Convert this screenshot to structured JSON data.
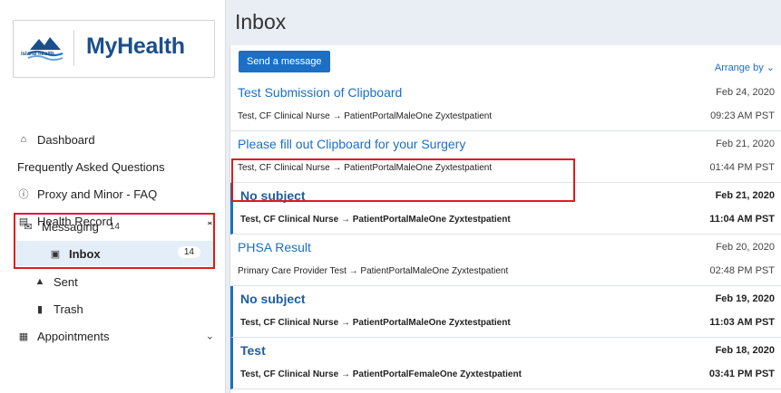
{
  "brand": {
    "title": "MyHealth",
    "mark_text": "island health"
  },
  "sidebar": {
    "items": [
      {
        "label": "Dashboard",
        "icon": "home-icon"
      },
      {
        "label": "Frequently Asked Questions"
      },
      {
        "label": "Proxy and Minor - FAQ",
        "icon": "help-circle-icon"
      },
      {
        "label": "Health Record",
        "icon": "clipboard-icon"
      },
      {
        "label": "Messaging",
        "icon": "envelope-icon",
        "badge": "14"
      },
      {
        "label": "Inbox",
        "icon": "inbox-icon",
        "badge": "14"
      },
      {
        "label": "Sent",
        "icon": "sent-icon"
      },
      {
        "label": "Trash",
        "icon": "trash-icon"
      },
      {
        "label": "Appointments",
        "icon": "calendar-icon"
      }
    ]
  },
  "main": {
    "title": "Inbox",
    "send_label": "Send a message",
    "arrange_label": "Arrange by",
    "messages": [
      {
        "subject": "Test Submission of Clipboard",
        "route": "Test, CF Clinical Nurse → PatientPortalMaleOne Zyxtestpatient",
        "date": "Feb 24, 2020",
        "time": "09:23 AM PST",
        "unread": false
      },
      {
        "subject": "Please fill out Clipboard for your Surgery",
        "route": "Test, CF Clinical Nurse → PatientPortalMaleOne Zyxtestpatient",
        "date": "Feb 21, 2020",
        "time": "01:44 PM PST",
        "unread": false
      },
      {
        "subject": "No subject",
        "route": "Test, CF Clinical Nurse → PatientPortalMaleOne Zyxtestpatient",
        "date": "Feb 21, 2020",
        "time": "11:04 AM PST",
        "unread": true
      },
      {
        "subject": "PHSA Result",
        "route": "Primary Care Provider Test → PatientPortalMaleOne Zyxtestpatient",
        "date": "Feb 20, 2020",
        "time": "02:48 PM PST",
        "unread": false
      },
      {
        "subject": "No subject",
        "route": "Test, CF Clinical Nurse → PatientPortalMaleOne Zyxtestpatient",
        "date": "Feb 19, 2020",
        "time": "11:03 AM PST",
        "unread": true
      },
      {
        "subject": "Test",
        "route": "Test, CF Clinical Nurse → PatientPortalFemaleOne Zyxtestpatient",
        "date": "Feb 18, 2020",
        "time": "03:41 PM PST",
        "unread": true
      }
    ]
  },
  "colors": {
    "accent": "#1b6fc4",
    "highlight": "#e01b1b",
    "selected": "#e4eef8"
  }
}
